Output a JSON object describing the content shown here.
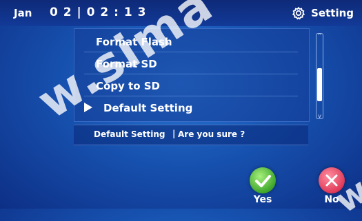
{
  "header": {
    "month": "Jan",
    "time": "0 2 | 0 2 : 1 3",
    "setting_label": "Setting",
    "setting_icon": "gear-icon"
  },
  "menu": {
    "items": [
      {
        "label": "Format Flash",
        "selected": false
      },
      {
        "label": "Format SD",
        "selected": false
      },
      {
        "label": "Copy to SD",
        "selected": false
      },
      {
        "label": "Default Setting",
        "selected": true
      }
    ]
  },
  "confirm": {
    "left": "Default Setting",
    "separator": "|",
    "right": "Are you sure ?"
  },
  "buttons": {
    "yes_label": "Yes",
    "no_label": "No"
  },
  "watermark": {
    "text": "w.sima",
    "text2": "w"
  },
  "colors": {
    "background": "#1752b0",
    "topbar": "#0e2a78",
    "yes": "#3fa62b",
    "no": "#e03a59"
  }
}
